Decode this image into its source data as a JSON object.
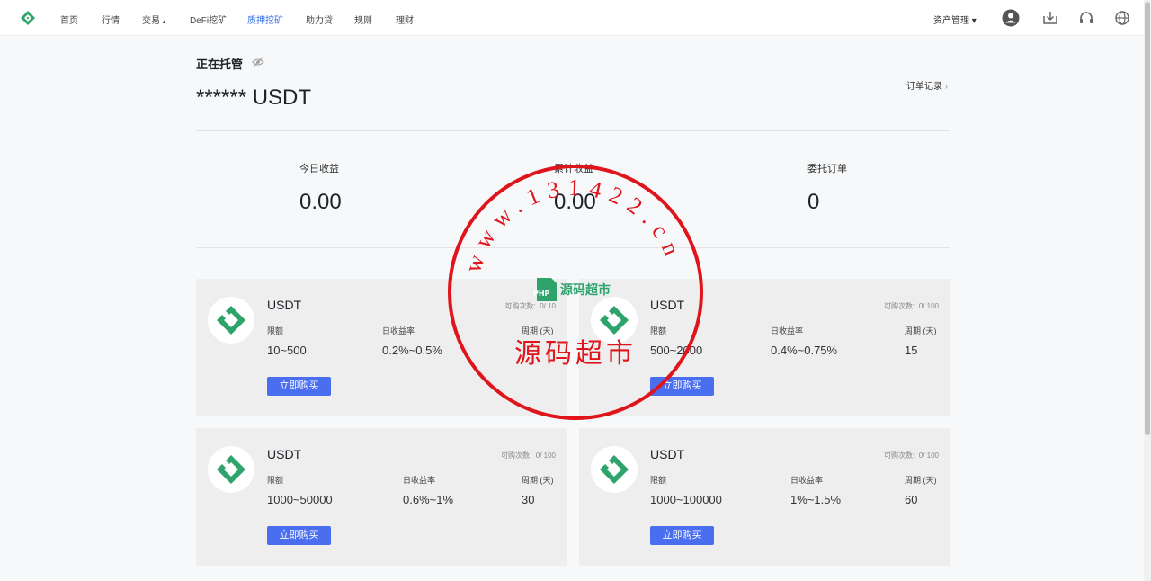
{
  "nav": {
    "items": [
      {
        "label": "首页",
        "active": false
      },
      {
        "label": "行情",
        "active": false
      },
      {
        "label": "交易",
        "active": false
      },
      {
        "label": "DeFi挖矿",
        "active": false
      },
      {
        "label": "质押挖矿",
        "active": true
      },
      {
        "label": "助力贷",
        "active": false
      },
      {
        "label": "规则",
        "active": false
      },
      {
        "label": "理财",
        "active": false
      }
    ],
    "trade_caret": "▴",
    "asset_management": "资产管理",
    "asset_caret": "▾",
    "icons": [
      "user-icon",
      "download-icon",
      "headset-icon",
      "globe-icon"
    ]
  },
  "hosting": {
    "title": "正在托管",
    "balance": "****** USDT",
    "order_record": "订单记录",
    "order_record_chevron": "›"
  },
  "stats": [
    {
      "label": "今日收益",
      "value": "0.00"
    },
    {
      "label": "累计收益",
      "value": "0.00"
    },
    {
      "label": "委托订单",
      "value": "0"
    }
  ],
  "products": [
    {
      "name": "USDT",
      "avail_label": "可购次数:",
      "avail_value": "0/ 10",
      "limit_label": "限额",
      "limit": "10~500",
      "rate_label": "日收益率",
      "rate": "0.2%~0.5%",
      "period_label": "周期 (天)",
      "period": "",
      "buy": "立即购买"
    },
    {
      "name": "USDT",
      "avail_label": "可购次数:",
      "avail_value": "0/ 100",
      "limit_label": "限额",
      "limit": "500~2000",
      "rate_label": "日收益率",
      "rate": "0.4%~0.75%",
      "period_label": "周期 (天)",
      "period": "15",
      "buy": "立即购买"
    },
    {
      "name": "USDT",
      "avail_label": "可购次数:",
      "avail_value": "0/ 100",
      "limit_label": "限额",
      "limit": "1000~50000",
      "rate_label": "日收益率",
      "rate": "0.6%~1%",
      "period_label": "周期 (天)",
      "period": "30",
      "buy": "立即购买"
    },
    {
      "name": "USDT",
      "avail_label": "可购次数:",
      "avail_value": "0/ 100",
      "limit_label": "限额",
      "limit": "1000~100000",
      "rate_label": "日收益率",
      "rate": "1%~1.5%",
      "period_label": "周期 (天)",
      "period": "60",
      "buy": "立即购买"
    }
  ],
  "watermark": {
    "ring_text": "www.131422.cn",
    "center_text": "源码超市",
    "badge_text": "源码超市",
    "badge_sub": "PHP",
    "color": "#e0141b"
  },
  "colors": {
    "accent_blue": "#3b73e8",
    "button_blue": "#4a6ef0",
    "brand_green": "#2ea36b"
  }
}
